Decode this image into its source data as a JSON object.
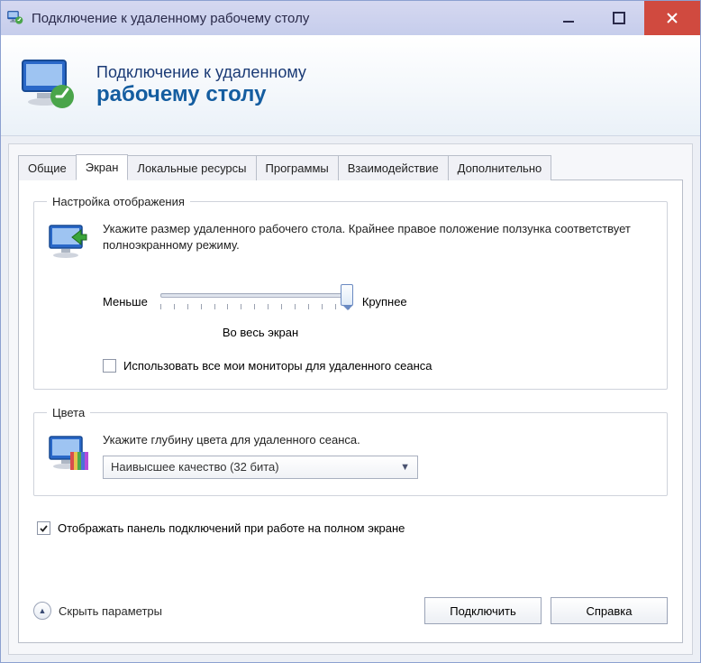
{
  "window": {
    "title": "Подключение к удаленному рабочему столу"
  },
  "banner": {
    "subtitle": "Подключение к удаленному",
    "title": "рабочему столу"
  },
  "tabs": [
    {
      "label": "Общие",
      "active": false
    },
    {
      "label": "Экран",
      "active": true
    },
    {
      "label": "Локальные ресурсы",
      "active": false
    },
    {
      "label": "Программы",
      "active": false
    },
    {
      "label": "Взаимодействие",
      "active": false
    },
    {
      "label": "Дополнительно",
      "active": false
    }
  ],
  "display_group": {
    "legend": "Настройка отображения",
    "description": "Укажите размер удаленного рабочего стола. Крайнее правое положение ползунка соответствует полноэкранному режиму.",
    "slider_min_label": "Меньше",
    "slider_max_label": "Крупнее",
    "slider_value_label": "Во весь экран",
    "multimonitors_label": "Использовать все мои мониторы для удаленного сеанса",
    "multimonitors_checked": false
  },
  "colors_group": {
    "legend": "Цвета",
    "description": "Укажите глубину цвета для удаленного сеанса.",
    "selected": "Наивысшее качество (32 бита)"
  },
  "footer_check": {
    "label": "Отображать панель подключений при работе на полном экране",
    "checked": true
  },
  "collapse_label": "Скрыть параметры",
  "buttons": {
    "connect": "Подключить",
    "help": "Справка"
  }
}
